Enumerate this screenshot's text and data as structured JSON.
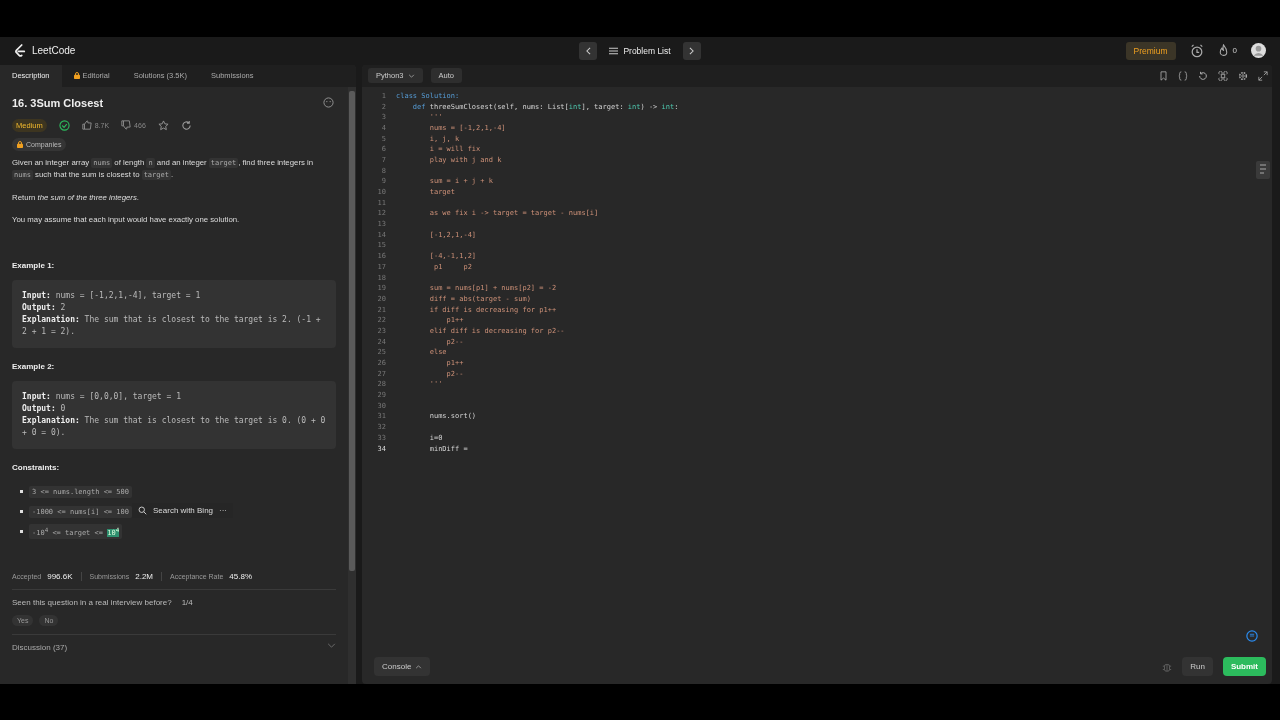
{
  "header": {
    "logo": "LeetCode",
    "nav_label": "Problem List",
    "premium": "Premium",
    "streak": "0"
  },
  "tabs": [
    {
      "label": "Description",
      "selected": true,
      "locked": false
    },
    {
      "label": "Editorial",
      "selected": false,
      "locked": true
    },
    {
      "label": "Solutions (3.5K)",
      "selected": false,
      "locked": false
    },
    {
      "label": "Submissions",
      "selected": false,
      "locked": false
    }
  ],
  "problem": {
    "title": "16. 3Sum Closest",
    "difficulty": "Medium",
    "solved": true,
    "likes": "8.7K",
    "dislikes": "466",
    "companies": "Companies",
    "paragraphs": [
      [
        {
          "text": "Given an integer array ",
          "kind": "text"
        },
        {
          "text": "nums",
          "kind": "code"
        },
        {
          "text": " of length ",
          "kind": "text"
        },
        {
          "text": "n",
          "kind": "code"
        },
        {
          "text": " and an integer ",
          "kind": "text"
        },
        {
          "text": "target",
          "kind": "code"
        },
        {
          "text": ", find three integers in ",
          "kind": "text"
        },
        {
          "text": "nums",
          "kind": "code"
        },
        {
          "text": " such that the sum is closest to ",
          "kind": "text"
        },
        {
          "text": "target",
          "kind": "code"
        },
        {
          "text": ".",
          "kind": "text"
        }
      ],
      [
        {
          "text": "Return ",
          "kind": "text"
        },
        {
          "text": "the sum of the three integers",
          "kind": "italic"
        },
        {
          "text": ".",
          "kind": "text"
        }
      ],
      [
        {
          "text": "You may assume that each input would have exactly one solution.",
          "kind": "text"
        }
      ]
    ],
    "examples": [
      {
        "title": "Example 1:",
        "lines": [
          "**Input:** nums = [-1,2,1,-4], target = 1",
          "**Output:** 2",
          "**Explanation:** The sum that is closest to the target is 2. (-1 + 2 + 1 = 2)."
        ]
      },
      {
        "title": "Example 2:",
        "lines": [
          "**Input:** nums = [0,0,0], target = 1",
          "**Output:** 0",
          "**Explanation:** The sum that is closest to the target is 0. (0 + 0 + 0 = 0)."
        ]
      }
    ],
    "constraints_title": "Constraints:",
    "constraints": [
      {
        "parts": [
          {
            "text": "3 <= nums.length <= 500",
            "selected": false
          }
        ]
      },
      {
        "parts": [
          {
            "text": "-1000 <= nums[i] <= 100",
            "selected": false
          }
        ]
      },
      {
        "parts": [
          {
            "text": "-10$^{4}$ <= target <= ",
            "selected": false
          },
          {
            "text": "10$^{4}$",
            "selected": true
          }
        ]
      }
    ],
    "selection_popup": {
      "label": "Search with Bing",
      "more": "···"
    },
    "stats": [
      {
        "label": "Accepted",
        "value": "996.6K"
      },
      {
        "label": "Submissions",
        "value": "2.2M"
      },
      {
        "label": "Acceptance Rate",
        "value": "45.8%"
      }
    ],
    "interview": {
      "question": "Seen this question in a real interview before?",
      "count": "1/4",
      "options": [
        "Yes",
        "No"
      ]
    },
    "discussion": "Discussion (37)"
  },
  "editor": {
    "language": "Python3",
    "mode": "Auto",
    "lines": [
      {
        "number": "1",
        "segments": [
          {
            "text": "class Solution:",
            "kind": "keyword"
          }
        ]
      },
      {
        "number": "2",
        "segments": [
          {
            "text": "    def ",
            "kind": "keyword"
          },
          {
            "text": "threeSumClosest(self, nums: List[",
            "kind": "plain"
          },
          {
            "text": "int",
            "kind": "type"
          },
          {
            "text": "], target: ",
            "kind": "plain"
          },
          {
            "text": "int",
            "kind": "type"
          },
          {
            "text": ") -> ",
            "kind": "plain"
          },
          {
            "text": "int",
            "kind": "type"
          },
          {
            "text": ":",
            "kind": "plain"
          }
        ]
      },
      {
        "number": "3",
        "segments": [
          {
            "text": "        '''",
            "kind": "string"
          }
        ]
      },
      {
        "number": "4",
        "segments": [
          {
            "text": "        nums = [-1,2,1,-4]",
            "kind": "string"
          }
        ]
      },
      {
        "number": "5",
        "segments": [
          {
            "text": "        i, j, k",
            "kind": "string"
          }
        ]
      },
      {
        "number": "6",
        "segments": [
          {
            "text": "        i = will fix",
            "kind": "string"
          }
        ]
      },
      {
        "number": "7",
        "segments": [
          {
            "text": "        play with j and k",
            "kind": "string"
          }
        ]
      },
      {
        "number": "8"
      },
      {
        "number": "9",
        "segments": [
          {
            "text": "        sum = i + j + k",
            "kind": "string"
          }
        ]
      },
      {
        "number": "10",
        "segments": [
          {
            "text": "        target",
            "kind": "string"
          }
        ]
      },
      {
        "number": "11"
      },
      {
        "number": "12",
        "segments": [
          {
            "text": "        as we fix i -> target = target - nums[i]",
            "kind": "string"
          }
        ]
      },
      {
        "number": "13"
      },
      {
        "number": "14",
        "segments": [
          {
            "text": "        [-1,2,1,-4]",
            "kind": "string"
          }
        ]
      },
      {
        "number": "15"
      },
      {
        "number": "16",
        "segments": [
          {
            "text": "        [-4,-1,1,2]",
            "kind": "string"
          }
        ]
      },
      {
        "number": "17",
        "segments": [
          {
            "text": "         p1     p2",
            "kind": "string"
          }
        ]
      },
      {
        "number": "18"
      },
      {
        "number": "19",
        "segments": [
          {
            "text": "        sum = nums[p1] + nums[p2] = -2",
            "kind": "string"
          }
        ]
      },
      {
        "number": "20",
        "segments": [
          {
            "text": "        diff = abs(target - sum)",
            "kind": "string"
          }
        ]
      },
      {
        "number": "21",
        "segments": [
          {
            "text": "        if diff is decreasing for p1++",
            "kind": "string"
          }
        ]
      },
      {
        "number": "22",
        "segments": [
          {
            "text": "            p1++",
            "kind": "string"
          }
        ]
      },
      {
        "number": "23",
        "segments": [
          {
            "text": "        elif diff is decreasing for p2--",
            "kind": "string"
          }
        ]
      },
      {
        "number": "24",
        "segments": [
          {
            "text": "            p2--",
            "kind": "string"
          }
        ]
      },
      {
        "number": "25",
        "segments": [
          {
            "text": "        else",
            "kind": "string"
          }
        ]
      },
      {
        "number": "26",
        "segments": [
          {
            "text": "            p1++",
            "kind": "string"
          }
        ]
      },
      {
        "number": "27",
        "segments": [
          {
            "text": "            p2--",
            "kind": "string"
          }
        ]
      },
      {
        "number": "28",
        "segments": [
          {
            "text": "        '''",
            "kind": "string"
          }
        ]
      },
      {
        "number": "29"
      },
      {
        "number": "30"
      },
      {
        "number": "31",
        "segments": [
          {
            "text": "        nums.sort()",
            "kind": "plain"
          }
        ]
      },
      {
        "number": "32"
      },
      {
        "number": "33",
        "segments": [
          {
            "text": "        i=0",
            "kind": "plain"
          }
        ]
      },
      {
        "number": "34",
        "current": true,
        "segments": [
          {
            "text": "        minDiff =",
            "kind": "plain"
          }
        ]
      }
    ],
    "console": "Console",
    "run": "Run",
    "submit": "Submit"
  }
}
